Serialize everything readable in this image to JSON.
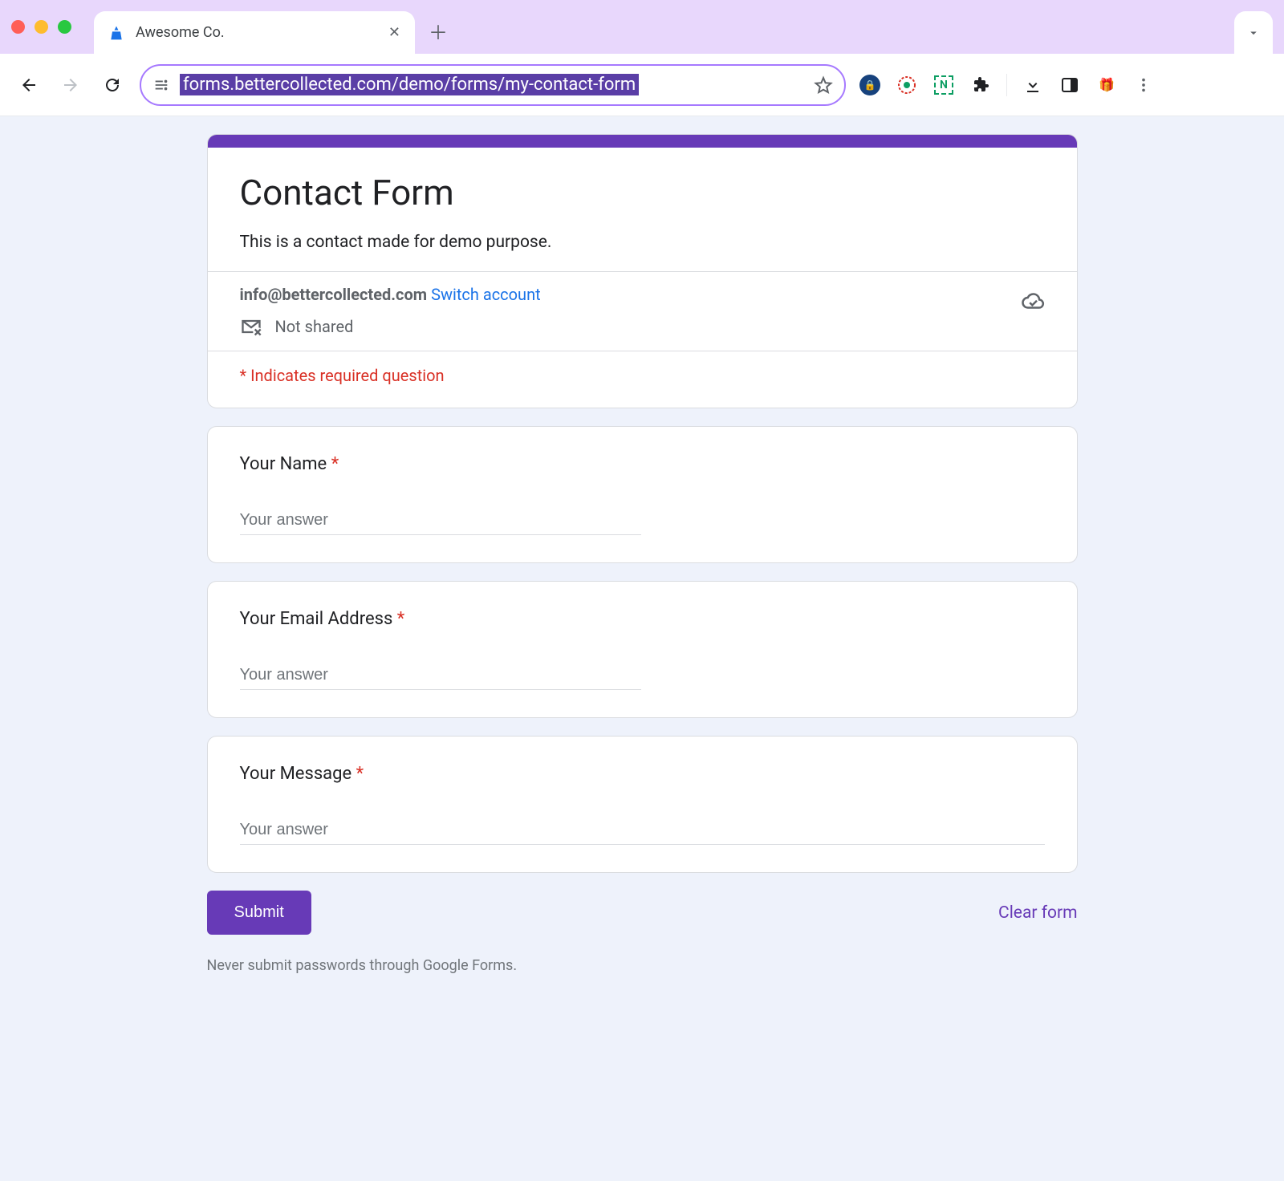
{
  "browser": {
    "tab_title": "Awesome Co.",
    "url": "forms.bettercollected.com/demo/forms/my-contact-form"
  },
  "header": {
    "title": "Contact Form",
    "description": "This is a contact made for demo purpose."
  },
  "account": {
    "email": "info@bettercollected.com",
    "switch_label": "Switch account",
    "not_shared_label": "Not shared"
  },
  "required_notice": "* Indicates required question",
  "questions": [
    {
      "label": "Your Name",
      "required": true,
      "placeholder": "Your answer",
      "wide": false
    },
    {
      "label": "Your Email Address",
      "required": true,
      "placeholder": "Your answer",
      "wide": false
    },
    {
      "label": "Your Message",
      "required": true,
      "placeholder": "Your answer",
      "wide": true
    }
  ],
  "actions": {
    "submit_label": "Submit",
    "clear_label": "Clear form"
  },
  "footer": {
    "warning": "Never submit passwords through Google Forms."
  },
  "colors": {
    "accent": "#673ab7",
    "danger": "#d93025",
    "link": "#1a73e8"
  }
}
